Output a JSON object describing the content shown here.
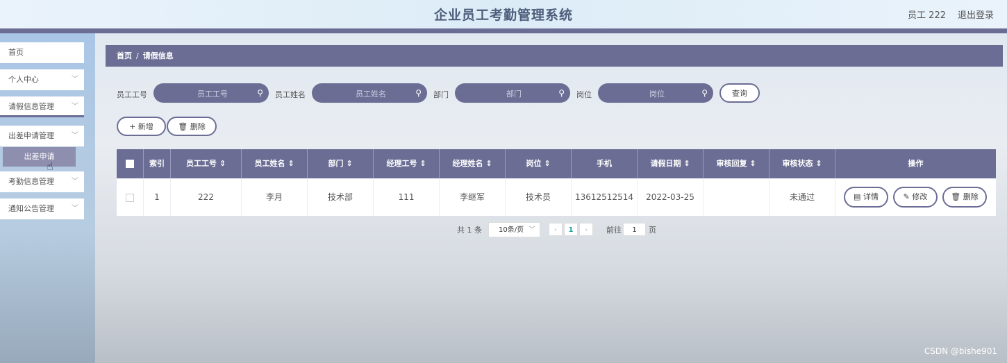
{
  "header": {
    "title": "企业员工考勤管理系统",
    "user": "员工 222",
    "logout": "退出登录"
  },
  "sidebar": {
    "items": [
      {
        "label": "首页",
        "chevron": false
      },
      {
        "label": "个人中心",
        "chevron": true
      },
      {
        "label": "请假信息管理",
        "chevron": true
      },
      {
        "label": "出差申请管理",
        "chevron": true
      },
      {
        "label": "考勤信息管理",
        "chevron": true
      },
      {
        "label": "通知公告管理",
        "chevron": true
      }
    ],
    "submenu": "出差申请"
  },
  "breadcrumb": {
    "home": "首页",
    "sep": "/",
    "current": "请假信息"
  },
  "filters": {
    "emp_no": {
      "label": "员工工号",
      "placeholder": "员工工号"
    },
    "emp_name": {
      "label": "员工姓名",
      "placeholder": "员工姓名"
    },
    "dept": {
      "label": "部门",
      "placeholder": "部门"
    },
    "position": {
      "label": "岗位",
      "placeholder": "岗位"
    },
    "query": "查询"
  },
  "toolbar": {
    "add": "新增",
    "delete": "删除"
  },
  "table": {
    "headers": [
      "索引",
      "员工工号",
      "员工姓名",
      "部门",
      "经理工号",
      "经理姓名",
      "岗位",
      "手机",
      "请假日期",
      "审核回复",
      "审核状态",
      "操作"
    ],
    "sort_mark": "⇕",
    "row": {
      "index": "1",
      "emp_no": "222",
      "emp_name": "李月",
      "dept": "技术部",
      "mgr_no": "111",
      "mgr_name": "李继军",
      "position": "技术员",
      "phone": "13612512514",
      "date": "2022-03-25",
      "reply": "",
      "status": "未通过"
    },
    "actions": {
      "detail": "详情",
      "edit": "修改",
      "delete": "删除"
    }
  },
  "pager": {
    "total": "共 1 条",
    "page_size": "10条/页",
    "current": "1",
    "goto": "前往",
    "goto_value": "1",
    "page_unit": "页"
  },
  "watermark": "CSDN @bishe901",
  "colors": {
    "accent": "#6b6d94",
    "sidebar": "#aac6e6"
  }
}
